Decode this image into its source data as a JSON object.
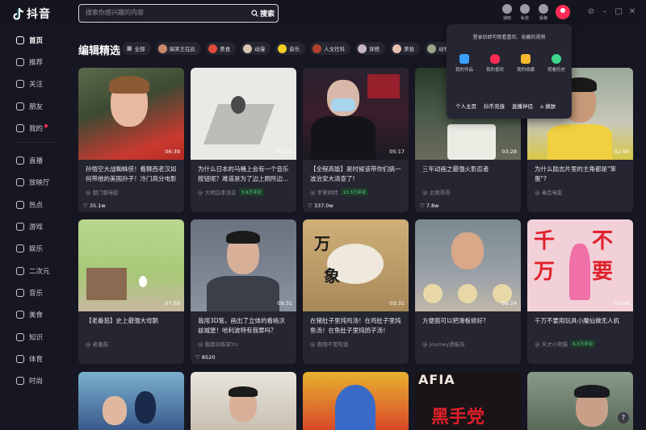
{
  "app": {
    "logo_text": "抖音"
  },
  "search": {
    "placeholder": "搜索你感兴趣的内容",
    "button": "搜索"
  },
  "top_icons": [
    {
      "label": "通知",
      "icon": "bell-icon"
    },
    {
      "label": "私信",
      "icon": "message-icon"
    },
    {
      "label": "投稿",
      "icon": "upload-icon"
    }
  ],
  "sidebar": {
    "items": [
      {
        "label": "首页",
        "icon": "home-icon",
        "active": true
      },
      {
        "label": "推荐",
        "icon": "thumb-up-icon"
      },
      {
        "label": "关注",
        "icon": "follow-icon"
      },
      {
        "label": "朋友",
        "icon": "friends-icon"
      },
      {
        "label": "我的",
        "icon": "profile-icon",
        "dot": true
      },
      {
        "label": "直播",
        "icon": "live-icon"
      },
      {
        "label": "放映厅",
        "icon": "theater-icon"
      },
      {
        "label": "热点",
        "icon": "fire-icon"
      },
      {
        "label": "游戏",
        "icon": "game-icon"
      },
      {
        "label": "娱乐",
        "icon": "entertainment-icon"
      },
      {
        "label": "二次元",
        "icon": "anime-icon"
      },
      {
        "label": "音乐",
        "icon": "music-icon"
      },
      {
        "label": "美食",
        "icon": "food-icon"
      },
      {
        "label": "知识",
        "icon": "knowledge-icon"
      },
      {
        "label": "体育",
        "icon": "sports-icon"
      },
      {
        "label": "时尚",
        "icon": "fashion-icon"
      }
    ]
  },
  "section": {
    "title": "编辑精选",
    "chips": [
      "全部",
      "搞笑王在此",
      "美食",
      "动漫",
      "音乐",
      "人文社科",
      "穿搭",
      "美妆",
      "动物宠物"
    ]
  },
  "videos": [
    {
      "likes": "35.1w",
      "duration": "06:39",
      "title": "孙悟空大战蜘蛛侠！看狮西老汉如何带他的美国孙子！冷门高分电影",
      "author": "@ 楚门聊电影",
      "tag": ""
    },
    {
      "likes": "",
      "duration": "01:09",
      "title": "为什么日本的马桶上会有一个音乐按钮呢？难道是为了边上厕所边...",
      "author": "@ 大明白李涅芬",
      "tag": "3.9万评论"
    },
    {
      "likes": "337.0w",
      "duration": "05:17",
      "title": "【全程高能】是时候该带你们搞一波治安大清查了!",
      "author": "@ 孝警阿特",
      "tag": "13.3万评论"
    },
    {
      "likes": "7.8w",
      "duration": "03:28",
      "title": "三年动画之最强火影忍者",
      "author": "@ 主观哥哥",
      "tag": ""
    },
    {
      "likes": "",
      "duration": "02:56",
      "title": "为什么励志片里的主角都是\"笨蛋\"?",
      "author": "@ 毒舌电影",
      "tag": ""
    },
    {
      "likes": "",
      "duration": "07:58",
      "title": "【老番茄】史上最强大母鹅",
      "author": "@ 老番茄",
      "tag": ""
    },
    {
      "likes": "8520",
      "duration": "09:31",
      "title": "我用3D笔，画出了立体的看格沃兹城堡！哈利波特有我罪吗？",
      "author": "@ 憨鹅训练家YU",
      "tag": ""
    },
    {
      "likes": "",
      "duration": "03:31",
      "title": "在猪肚子里炖鸡汤！在鸡肚子里炖鱼汤！在鱼肚子里炖鸽子汤！",
      "author": "@ 南翔不爱吃饭",
      "tag": ""
    },
    {
      "likes": "",
      "duration": "09:24",
      "title": "方便面可以把滑板修好?",
      "author": "@ Journey滑板店",
      "tag": ""
    },
    {
      "likes": "",
      "duration": "04:06",
      "title": "千万不要用玩具小魔仙做无人机",
      "author": "@ 天才小熊猫",
      "tag": "6.5万评论"
    }
  ],
  "popup": {
    "hint": "登录后即可观看喜欢、收藏的视频",
    "items": [
      {
        "label": "我的作品",
        "icon": "works-icon",
        "color": "#3aa0ff"
      },
      {
        "label": "我的喜欢",
        "icon": "heart-icon",
        "color": "#fe2c55"
      },
      {
        "label": "我的收藏",
        "icon": "star-icon",
        "color": "#f5b82e"
      },
      {
        "label": "观看历史",
        "icon": "history-icon",
        "color": "#3dd68c"
      }
    ],
    "actions": [
      "个人主页",
      "抖币充值",
      "直播伴侣",
      "换肤"
    ]
  },
  "colors": {
    "accent": "#fe2c55",
    "background": "#161722",
    "card": "#252632"
  }
}
